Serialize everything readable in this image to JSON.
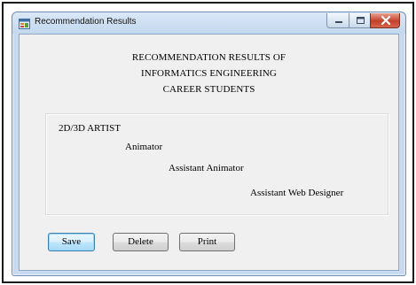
{
  "window": {
    "title": "Recommendation Results"
  },
  "header": {
    "line1": "RECOMMENDATION RESULTS OF",
    "line2": "INFORMATICS ENGINEERING",
    "line3": "CAREER STUDENTS"
  },
  "results": [
    "2D/3D ARTIST",
    "Animator",
    "Assistant Animator",
    "Assistant Web Designer"
  ],
  "buttons": {
    "save_label": "Save",
    "delete_label": "Delete",
    "print_label": "Print"
  },
  "icons": {
    "app": "app-form-icon",
    "minimize": "minimize-icon",
    "maximize": "maximize-icon",
    "close": "close-icon"
  },
  "colors": {
    "titlebar": "#c7daf0",
    "client_background": "#f0f0f0",
    "close_button": "#c2402a",
    "default_button_accent": "#3c7fb1"
  }
}
